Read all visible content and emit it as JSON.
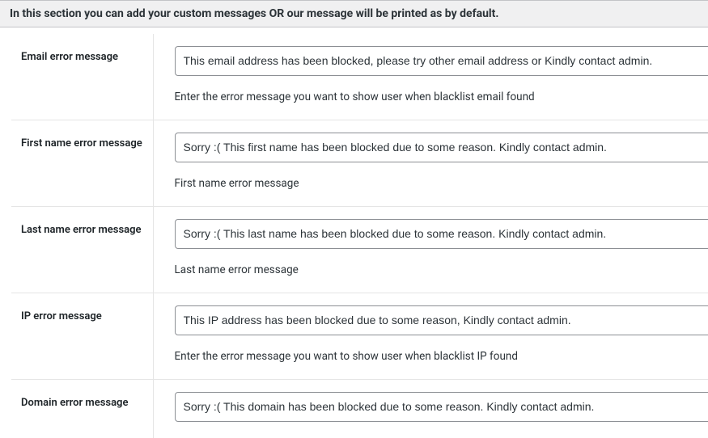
{
  "section": {
    "header": "In this section you can add your custom messages OR our message will be printed as by default."
  },
  "fields": {
    "email": {
      "label": "Email error message",
      "value": "This email address has been blocked, please try other email address or Kindly contact admin.",
      "description": "Enter the error message you want to show user when blacklist email found"
    },
    "first_name": {
      "label": "First name error message",
      "value": "Sorry :( This first name has been blocked due to some reason. Kindly contact admin.",
      "description": "First name error message"
    },
    "last_name": {
      "label": "Last name error message",
      "value": "Sorry :( This last name has been blocked due to some reason. Kindly contact admin.",
      "description": "Last name error message"
    },
    "ip": {
      "label": "IP error message",
      "value": "This IP address has been blocked due to some reason, Kindly contact admin.",
      "description": "Enter the error message you want to show user when blacklist IP found"
    },
    "domain": {
      "label": "Domain error message",
      "value": "Sorry :( This domain has been blocked due to some reason. Kindly contact admin.",
      "description": ""
    }
  }
}
